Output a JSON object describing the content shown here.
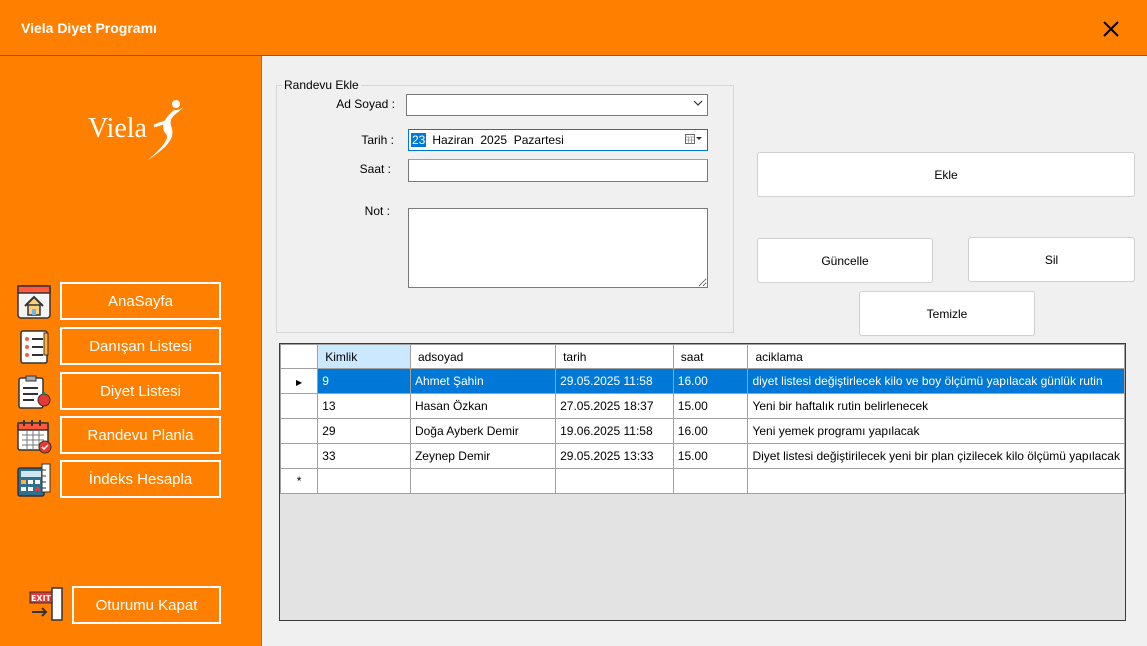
{
  "window": {
    "title": "Viela Diyet Programı"
  },
  "logo": {
    "text": "Viela"
  },
  "nav": {
    "home": "AnaSayfa",
    "clients": "Danışan Listesi",
    "diets": "Diyet Listesi",
    "appointments": "Randevu Planla",
    "index": "İndeks Hesapla",
    "logout": "Oturumu Kapat",
    "exit_icon_text": "EXIT"
  },
  "form": {
    "group_title": "Randevu Ekle",
    "name_label": "Ad Soyad :",
    "name_value": "",
    "date_label": "Tarih :",
    "date_day": "23",
    "date_rest": "Haziran  2025  Pazartesi",
    "time_label": "Saat :",
    "time_value": "",
    "note_label": "Not :",
    "note_value": ""
  },
  "buttons": {
    "add": "Ekle",
    "update": "Güncelle",
    "delete": "Sil",
    "clear": "Temizle"
  },
  "grid": {
    "columns": [
      "Kimlik",
      "adsoyad",
      "tarih",
      "saat",
      "aciklama"
    ],
    "rows": [
      [
        "9",
        "Ahmet Şahin",
        "29.05.2025 11:58",
        "16.00",
        "diyet listesi değiştirlecek kilo ve boy ölçümü yapılacak günlük rutin"
      ],
      [
        "13",
        "Hasan Özkan",
        "27.05.2025 18:37",
        "15.00",
        "Yeni bir haftalık rutin belirlenecek"
      ],
      [
        "29",
        "Doğa Ayberk Demir",
        "19.06.2025 11:58",
        "16.00",
        "Yeni yemek programı yapılacak"
      ],
      [
        "33",
        "Zeynep Demir",
        "29.05.2025 13:33",
        "15.00",
        "Diyet listesi değiştirilecek yeni bir plan çizilecek kilo ölçümü yapılacak"
      ]
    ],
    "selected_row": 0,
    "new_row_marker": "*",
    "current_row_marker": "▶"
  },
  "colors": {
    "accent": "#ff8000",
    "selection": "#0078d7"
  }
}
